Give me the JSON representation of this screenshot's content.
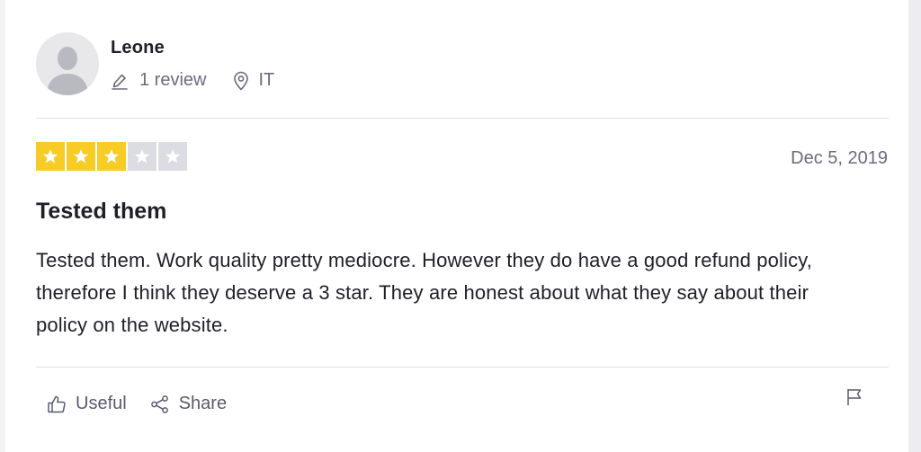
{
  "reviewer": {
    "name": "Leone",
    "review_count": "1 review",
    "country": "IT",
    "avatar_icon": "person-silhouette-icon"
  },
  "review": {
    "rating": 3,
    "max_rating": 5,
    "date": "Dec 5, 2019",
    "title": "Tested them",
    "body": "Tested them. Work quality pretty mediocre. However they do have a good refund policy, therefore I think they deserve a 3 star. They are honest about what they say about their policy on the website."
  },
  "actions": {
    "useful_label": "Useful",
    "share_label": "Share",
    "useful_icon": "thumbs-up-icon",
    "share_icon": "share-icon",
    "flag_icon": "flag-icon"
  },
  "colors": {
    "star_filled": "#f7cc24",
    "star_empty": "#dcdce3",
    "text_muted": "#6b6b80"
  }
}
